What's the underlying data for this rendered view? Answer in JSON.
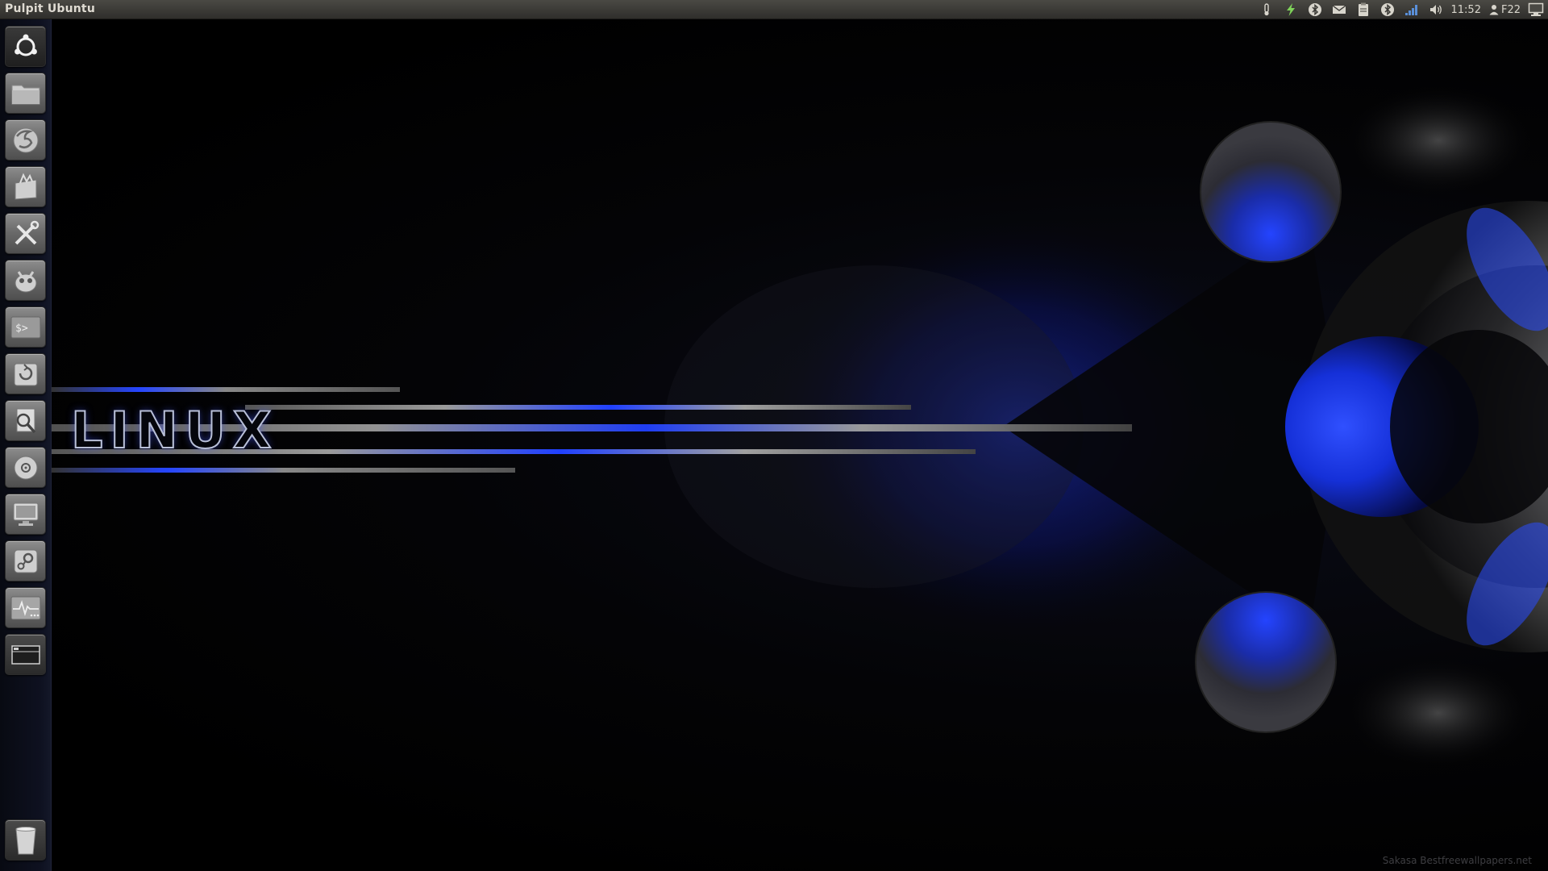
{
  "panel": {
    "title": "Pulpit Ubuntu",
    "clock": "11:52",
    "user": "F22"
  },
  "indicators": [
    {
      "icon": "temperature-icon"
    },
    {
      "icon": "power-bolt-icon"
    },
    {
      "icon": "bluetooth-icon"
    },
    {
      "icon": "mail-icon"
    },
    {
      "icon": "clipboard-icon"
    },
    {
      "icon": "bluetooth-icon"
    },
    {
      "icon": "network-signal-icon"
    },
    {
      "icon": "volume-icon"
    }
  ],
  "launcher": {
    "items": [
      {
        "icon": "ubuntu-logo-icon"
      },
      {
        "icon": "folder-icon"
      },
      {
        "icon": "firefox-icon"
      },
      {
        "icon": "software-center-icon"
      },
      {
        "icon": "settings-tools-icon"
      },
      {
        "icon": "gimp-icon"
      },
      {
        "icon": "terminal-icon"
      },
      {
        "icon": "update-manager-icon"
      },
      {
        "icon": "search-file-icon"
      },
      {
        "icon": "music-player-icon"
      },
      {
        "icon": "display-icon"
      },
      {
        "icon": "steam-icon"
      },
      {
        "icon": "system-monitor-icon"
      },
      {
        "icon": "workspace-switcher-icon"
      },
      {
        "icon": "trash-icon"
      }
    ]
  },
  "wallpaper": {
    "text": "LINUX",
    "watermark": "Sakasa Bestfreewallpapers.net",
    "colors": {
      "accent_blue": "#1a35ff",
      "highlight": "#ffffff",
      "background": "#000000"
    }
  }
}
